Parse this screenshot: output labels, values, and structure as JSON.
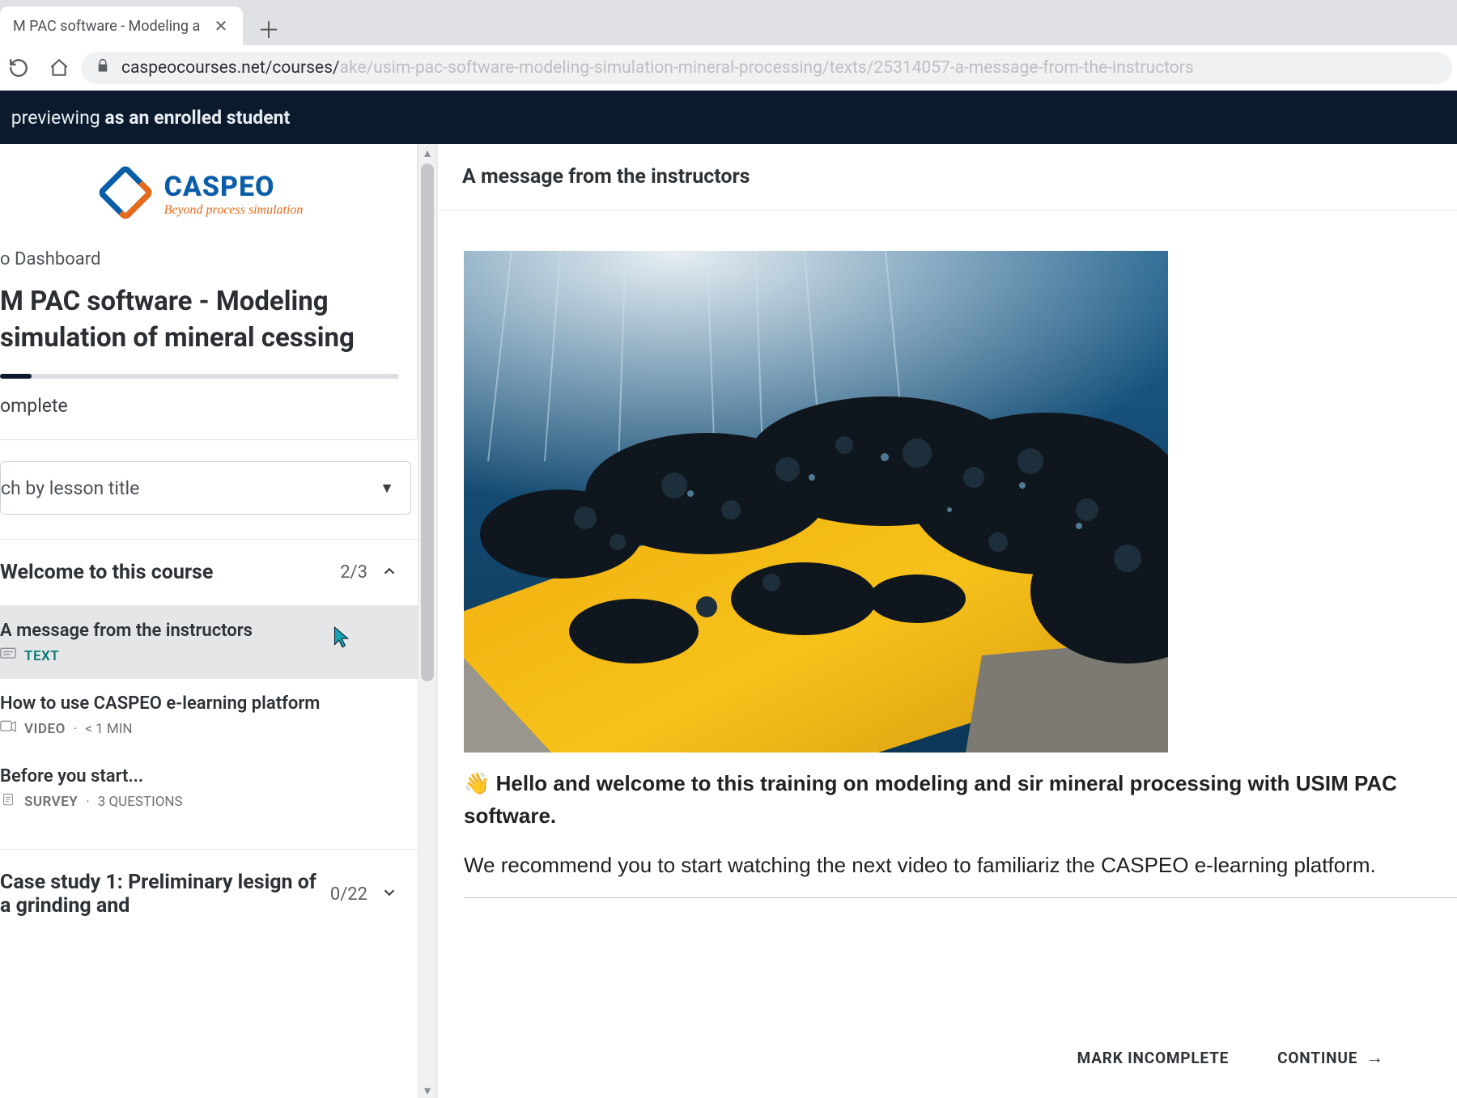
{
  "browser": {
    "tab_title": "M PAC software - Modeling a",
    "url_dark": "caspeocourses.net/courses/",
    "url_light": "ake/usim-pac-software-modeling-simulation-mineral-processing/texts/25314057-a-message-from-the-instructors"
  },
  "preview_bar": {
    "prefix": "previewing ",
    "bold": "as an enrolled student"
  },
  "logo": {
    "brand": "CASPEO",
    "tagline": "Beyond process simulation"
  },
  "sidebar": {
    "dashboard_link": "o Dashboard",
    "course_title": "M PAC software - Modeling simulation of mineral cessing",
    "progress_label": "omplete",
    "search_placeholder": "ch by lesson title",
    "chapters": [
      {
        "title": "Welcome to this course",
        "count": "2/3",
        "expanded": true,
        "lessons": [
          {
            "title": "A message from the instructors",
            "type": "TEXT",
            "meta": "",
            "active": true
          },
          {
            "title": "How to use CASPEO e-learning platform",
            "type": "VIDEO",
            "meta": "< 1 MIN",
            "active": false
          },
          {
            "title": "Before you start...",
            "type": "SURVEY",
            "meta": "3 QUESTIONS",
            "active": false
          }
        ]
      },
      {
        "title": "Case study 1: Preliminary lesign of a grinding and",
        "count": "0/22",
        "expanded": false,
        "lessons": []
      }
    ]
  },
  "main": {
    "heading": "A message from the instructors",
    "welcome_bold": "Hello and welcome to this training on modeling and sir mineral processing with USIM PAC software.",
    "paragraph2": "We recommend you to start watching the next video to familiariz the CASPEO e-learning platform.",
    "mark_incomplete": "MARK INCOMPLETE",
    "continue": "CONTINUE"
  }
}
